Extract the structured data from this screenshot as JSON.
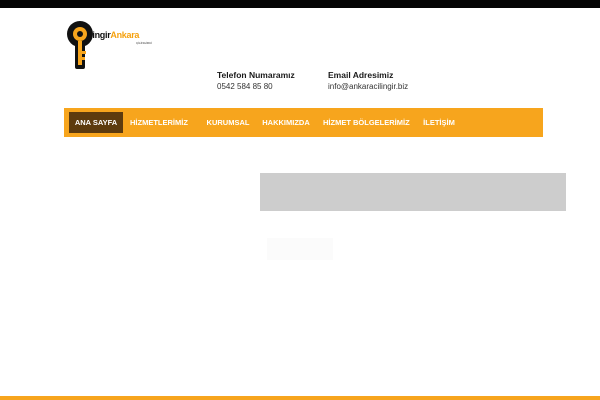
{
  "brand": {
    "word_dark": "İlingir",
    "word_orange": "Ankara",
    "sub": "ÇİLİNGİRCİ",
    "colors": {
      "orange": "#f7a51d",
      "dark": "#111111"
    }
  },
  "contact": {
    "phone_label": "Telefon Numaramız",
    "phone_value": "0542 584 85 80",
    "email_label": "Email Adresimiz",
    "email_value": "info@ankaracilingir.biz"
  },
  "nav": {
    "items": [
      {
        "label": "ANA SAYFA",
        "active": true
      },
      {
        "label": "HİZMETLERİMİZ",
        "active": false
      },
      {
        "label": "KURUMSAL",
        "active": false
      },
      {
        "label": "HAKKIMIZDA",
        "active": false
      },
      {
        "label": "HİZMET BÖLGELERİMİZ",
        "active": false
      },
      {
        "label": "İLETİŞİM",
        "active": false
      }
    ],
    "colors": {
      "bar": "#f7a51d",
      "active": "#5d3b0e",
      "text": "#ffffff"
    }
  }
}
